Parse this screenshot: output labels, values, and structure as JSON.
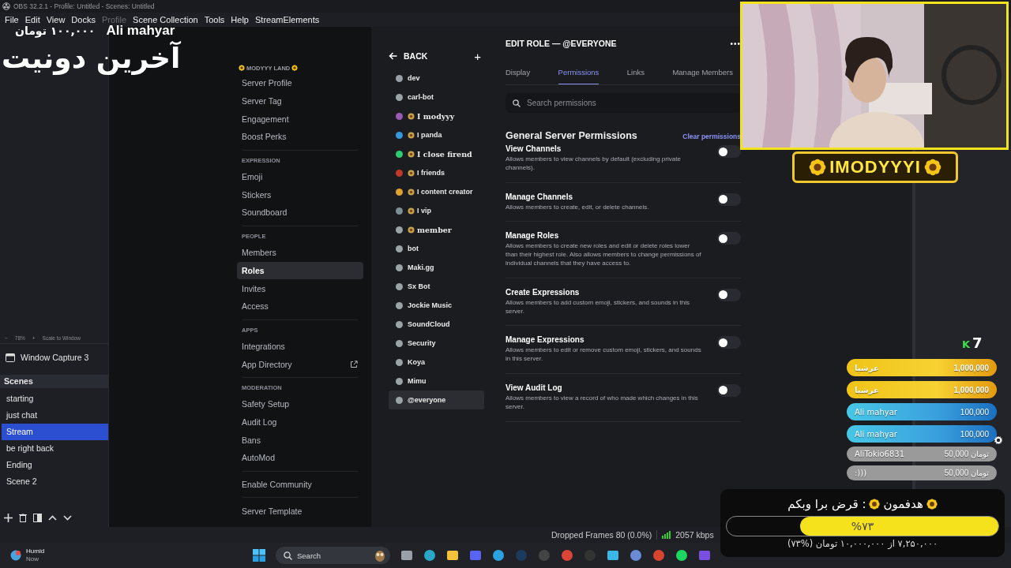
{
  "window": {
    "title": "OBS 32.2.1 - Profile: Untitled - Scenes: Untitled"
  },
  "menu": [
    {
      "label": "File",
      "disabled": false
    },
    {
      "label": "Edit",
      "disabled": false
    },
    {
      "label": "View",
      "disabled": false
    },
    {
      "label": "Docks",
      "disabled": false
    },
    {
      "label": "Profile",
      "disabled": true
    },
    {
      "label": "Scene Collection",
      "disabled": false
    },
    {
      "label": "Tools",
      "disabled": false
    },
    {
      "label": "Help",
      "disabled": false
    },
    {
      "label": "StreamElements",
      "disabled": false
    }
  ],
  "preview_toolbar": {
    "zoom_out": "−",
    "zoom": "78%",
    "zoom_in": "+",
    "scale": "Scale to Window"
  },
  "source": {
    "label": "Window Capture 3"
  },
  "scenes": {
    "title": "Scenes",
    "items": [
      {
        "label": "starting",
        "selected": false
      },
      {
        "label": "just chat",
        "selected": false
      },
      {
        "label": "Stream",
        "selected": true
      },
      {
        "label": "be right back",
        "selected": false
      },
      {
        "label": "Ending",
        "selected": false
      },
      {
        "label": "Scene 2",
        "selected": false
      }
    ]
  },
  "discord": {
    "server_name": "MODYYY LAND",
    "sidebar": [
      {
        "kind": "item",
        "label": "Server Profile",
        "selected": false
      },
      {
        "kind": "item",
        "label": "Server Tag",
        "selected": false
      },
      {
        "kind": "item",
        "label": "Engagement",
        "selected": false
      },
      {
        "kind": "item",
        "label": "Boost Perks",
        "selected": false
      },
      {
        "kind": "header",
        "label": "EXPRESSION"
      },
      {
        "kind": "item",
        "label": "Emoji",
        "selected": false
      },
      {
        "kind": "item",
        "label": "Stickers",
        "selected": false
      },
      {
        "kind": "item",
        "label": "Soundboard",
        "selected": false
      },
      {
        "kind": "header",
        "label": "PEOPLE"
      },
      {
        "kind": "item",
        "label": "Members",
        "selected": false
      },
      {
        "kind": "item",
        "label": "Roles",
        "selected": true
      },
      {
        "kind": "item",
        "label": "Invites",
        "selected": false
      },
      {
        "kind": "item",
        "label": "Access",
        "selected": false
      },
      {
        "kind": "header",
        "label": "APPS"
      },
      {
        "kind": "item",
        "label": "Integrations",
        "selected": false
      },
      {
        "kind": "link",
        "label": "App Directory",
        "selected": false
      },
      {
        "kind": "header",
        "label": "MODERATION"
      },
      {
        "kind": "item",
        "label": "Safety Setup",
        "selected": false
      },
      {
        "kind": "item",
        "label": "Audit Log",
        "selected": false
      },
      {
        "kind": "item",
        "label": "Bans",
        "selected": false
      },
      {
        "kind": "item",
        "label": "AutoMod",
        "selected": false
      },
      {
        "kind": "divider"
      },
      {
        "kind": "item",
        "label": "Enable Community",
        "selected": false
      },
      {
        "kind": "divider"
      },
      {
        "kind": "item",
        "label": "Server Template",
        "selected": false
      }
    ],
    "back": "BACK",
    "add": "+",
    "roles": [
      {
        "name": "dev",
        "color": "#9a9ea6",
        "emoji": false,
        "kind": "plain",
        "selected": false
      },
      {
        "name": "carl-bot",
        "color": "#9aa4a6",
        "emoji": false,
        "kind": "plain",
        "selected": false
      },
      {
        "name": "I modyyy",
        "color": "#9b59b6",
        "emoji": true,
        "kind": "fancy",
        "selected": false
      },
      {
        "name": "I panda",
        "color": "#3498db",
        "emoji": true,
        "kind": "plain",
        "selected": false
      },
      {
        "name": "I close firend",
        "color": "#2ecc71",
        "emoji": true,
        "kind": "fancy",
        "selected": false
      },
      {
        "name": "I friends",
        "color": "#c0392b",
        "emoji": true,
        "kind": "plain",
        "selected": false
      },
      {
        "name": "I content creator",
        "color": "#e0a030",
        "emoji": true,
        "kind": "plain",
        "selected": false
      },
      {
        "name": "I vip",
        "color": "#7f9095",
        "emoji": true,
        "kind": "plain",
        "selected": false
      },
      {
        "name": "member",
        "color": "#9aa4a6",
        "emoji": true,
        "kind": "fancy",
        "selected": false
      },
      {
        "name": "bot",
        "color": "#9aa4a6",
        "emoji": false,
        "kind": "plain",
        "selected": false
      },
      {
        "name": "Maki.gg",
        "color": "#9aa4a6",
        "emoji": false,
        "kind": "plain",
        "selected": false
      },
      {
        "name": "Sx Bot",
        "color": "#9aa4a6",
        "emoji": false,
        "kind": "plain",
        "selected": false
      },
      {
        "name": "Jockie Music",
        "color": "#9aa4a6",
        "emoji": false,
        "kind": "plain",
        "selected": false
      },
      {
        "name": "SoundCloud",
        "color": "#9aa4a6",
        "emoji": false,
        "kind": "plain",
        "selected": false
      },
      {
        "name": "Security",
        "color": "#9aa4a6",
        "emoji": false,
        "kind": "plain",
        "selected": false
      },
      {
        "name": "Koya",
        "color": "#9aa4a6",
        "emoji": false,
        "kind": "plain",
        "selected": false
      },
      {
        "name": "Mimu",
        "color": "#9aa4a6",
        "emoji": false,
        "kind": "plain",
        "selected": false
      },
      {
        "name": "@everyone",
        "color": "#9aa4a6",
        "emoji": false,
        "kind": "plain",
        "selected": true
      }
    ],
    "editor": {
      "title": "EDIT ROLE — @EVERYONE",
      "more": "•••",
      "tabs": [
        {
          "label": "Display",
          "selected": false
        },
        {
          "label": "Permissions",
          "selected": true
        },
        {
          "label": "Links",
          "selected": false
        },
        {
          "label": "Manage Members",
          "selected": false
        }
      ],
      "search": {
        "placeholder": "Search permissions"
      },
      "section": "General Server Permissions",
      "clear": "Clear permissions",
      "permissions": [
        {
          "name": "View Channels",
          "description": "Allows members to view channels by default (excluding private channels).",
          "on": false
        },
        {
          "name": "Manage Channels",
          "description": "Allows members to create, edit, or delete channels.",
          "on": false
        },
        {
          "name": "Manage Roles",
          "description": "Allows members to create new roles and edit or delete roles lower than their highest role. Also allows members to change permissions of individual channels that they have access to.",
          "on": false
        },
        {
          "name": "Create Expressions",
          "description": "Allows members to add custom emoji, stickers, and sounds in this server.",
          "on": false
        },
        {
          "name": "Manage Expressions",
          "description": "Allows members to edit or remove custom emoji, stickers, and sounds in this server.",
          "on": false
        },
        {
          "name": "View Audit Log",
          "description": "Allows members to view a record of who made which changes in this server.",
          "on": false
        }
      ]
    }
  },
  "status_bar": {
    "dropped": "Dropped Frames 80 (0.0%)",
    "bitrate": "2057 kbps"
  },
  "taskbar": {
    "weather": {
      "label": "Humid",
      "time": "Now"
    },
    "search": {
      "placeholder": "Search"
    }
  },
  "overlay": {
    "last_donation": {
      "title": "آخرین دونیت",
      "name": "Ali mahyar",
      "amount": "۱۰۰,۰۰۰ تومان"
    },
    "banner": "IMODYYYI",
    "logo": [
      {
        "text": "K",
        "color": "#3ee04a"
      },
      {
        "text": "7",
        "color": "#ffffff"
      }
    ],
    "donations": [
      {
        "name": "عرشیا",
        "amount": "1,000,000",
        "kind": "gold"
      },
      {
        "name": "عرشیا",
        "amount": "1,000,000",
        "kind": "gold"
      },
      {
        "name": "Ali mahyar",
        "amount": "100,000",
        "kind": "blue"
      },
      {
        "name": "Ali mahyar",
        "amount": "100,000",
        "kind": "blue"
      },
      {
        "name": "AliTokio6831",
        "amount": "50,000 تومان",
        "kind": "gray"
      },
      {
        "name": ":)))",
        "amount": "50,000 تومان",
        "kind": "gray"
      }
    ],
    "goal": {
      "title": "هدفمون",
      "subtitle": ": قرض برا وبکم",
      "level": 0.73,
      "percent": "%۷۳",
      "detail": "۷,۲۵۰,۰۰۰ از ۱۰,۰۰۰,۰۰۰ تومان (%۷۳)"
    }
  }
}
